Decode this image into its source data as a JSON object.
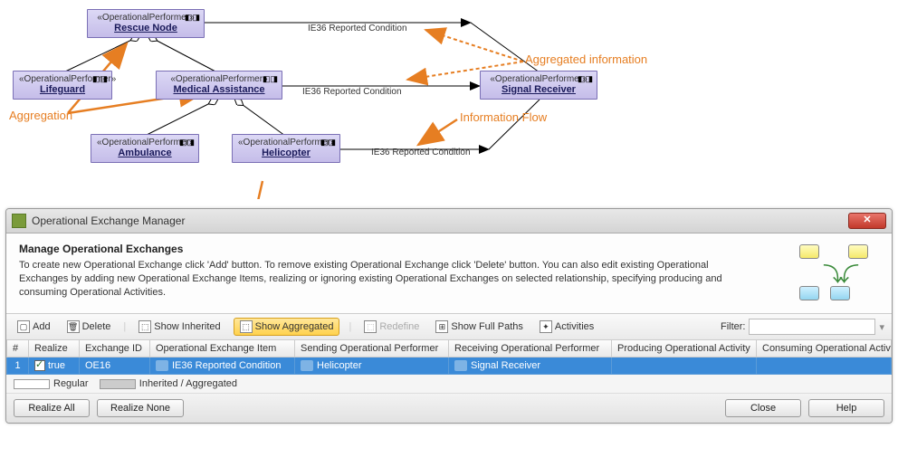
{
  "diagram": {
    "stereotype": "«OperationalPerformer»",
    "nodes": {
      "rescue": "Rescue Node",
      "lifeguard": "Lifeguard",
      "medical": "Medical Assistance",
      "signal": "Signal Receiver",
      "ambulance": "Ambulance",
      "helicopter": "Helicopter"
    },
    "flow_labels": {
      "f1": "IE36 Reported Condition",
      "f2": "IE36 Reported Condition",
      "f3": "IE36 Reported Condition"
    },
    "annotations": {
      "aggregated_info": "Aggregated information",
      "aggregation": "Aggregation",
      "info_flow": "Information Flow"
    }
  },
  "dialog": {
    "title": "Operational Exchange Manager",
    "heading": "Manage Operational Exchanges",
    "description": "To create new Operational Exchange click 'Add' button. To remove existing Operational Exchange click 'Delete' button. You can also edit existing Operational Exchanges by adding new Operational Exchange Items, realizing or ignoring existing Operational Exchanges on selected relationship, specifying producing and consuming Operational Activities.",
    "toolbar": {
      "add": "Add",
      "delete": "Delete",
      "show_inherited": "Show Inherited",
      "show_aggregated": "Show Aggregated",
      "redefine": "Redefine",
      "show_full_paths": "Show Full Paths",
      "activities": "Activities",
      "filter_label": "Filter:"
    },
    "columns": {
      "num": "#",
      "realize": "Realize",
      "exchange_id": "Exchange ID",
      "item": "Operational Exchange Item",
      "sending": "Sending Operational Performer",
      "receiving": "Receiving Operational Performer",
      "producing": "Producing Operational Activity",
      "consuming": "Consuming Operational Activity"
    },
    "rows": [
      {
        "num": "1",
        "realize_checked": true,
        "realize_text": "true",
        "exchange_id": "OE16",
        "item": "IE36 Reported Condition",
        "sending": "Helicopter",
        "receiving": "Signal Receiver",
        "producing": "",
        "consuming": ""
      }
    ],
    "legend": {
      "regular": "Regular",
      "inherited": "Inherited / Aggregated"
    },
    "buttons": {
      "realize_all": "Realize All",
      "realize_none": "Realize None",
      "close": "Close",
      "help": "Help"
    }
  },
  "chart_data": {
    "type": "diagram",
    "nodes": [
      {
        "id": "rescue",
        "label": "Rescue Node",
        "stereotype": "OperationalPerformer"
      },
      {
        "id": "lifeguard",
        "label": "Lifeguard",
        "stereotype": "OperationalPerformer"
      },
      {
        "id": "medical",
        "label": "Medical Assistance",
        "stereotype": "OperationalPerformer"
      },
      {
        "id": "signal",
        "label": "Signal Receiver",
        "stereotype": "OperationalPerformer"
      },
      {
        "id": "ambulance",
        "label": "Ambulance",
        "stereotype": "OperationalPerformer"
      },
      {
        "id": "helicopter",
        "label": "Helicopter",
        "stereotype": "OperationalPerformer"
      }
    ],
    "aggregations": [
      {
        "whole": "rescue",
        "part": "lifeguard"
      },
      {
        "whole": "rescue",
        "part": "medical"
      },
      {
        "whole": "medical",
        "part": "ambulance"
      },
      {
        "whole": "medical",
        "part": "helicopter"
      }
    ],
    "information_flows": [
      {
        "from": "rescue",
        "to": "signal",
        "label": "IE36 Reported Condition",
        "aggregated": true
      },
      {
        "from": "medical",
        "to": "signal",
        "label": "IE36 Reported Condition",
        "aggregated": true
      },
      {
        "from": "helicopter",
        "to": "signal",
        "label": "IE36 Reported Condition",
        "aggregated": false
      }
    ]
  }
}
